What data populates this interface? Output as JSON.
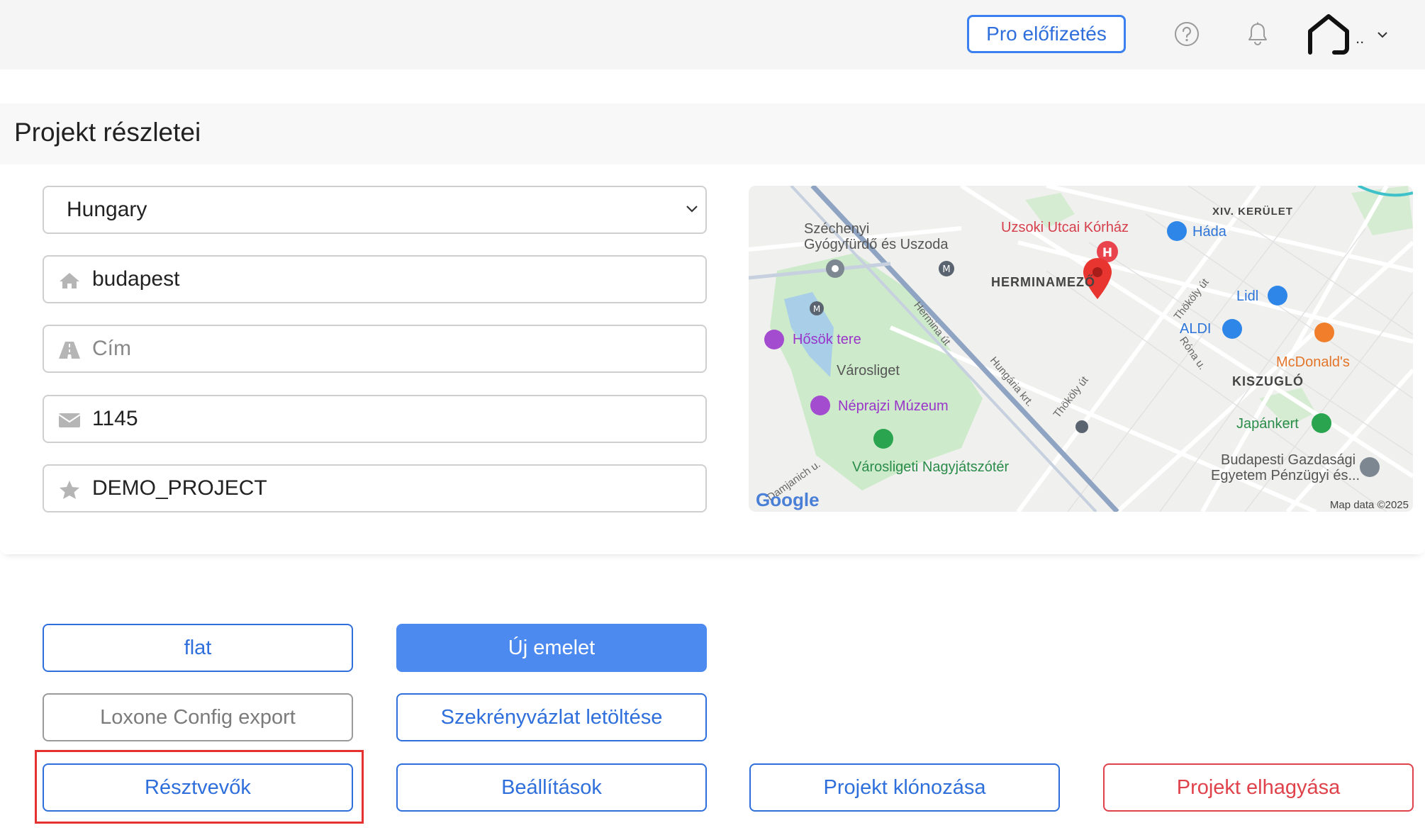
{
  "topbar": {
    "pro_label": "Pro előfizetés",
    "help_icon": "question-circle-icon",
    "bell_icon": "bell-icon",
    "logo_icon": "house-logo-icon",
    "logo_suffix": ".."
  },
  "details": {
    "title": "Projekt részletei",
    "country": {
      "value": "Hungary",
      "icon": "chevron-down-icon"
    },
    "city": {
      "value": "budapest",
      "icon": "home-icon"
    },
    "address": {
      "placeholder": "Cím",
      "icon": "road-icon"
    },
    "zip": {
      "value": "1145",
      "icon": "envelope-icon"
    },
    "project_name": {
      "value": "DEMO_PROJECT",
      "icon": "star-icon"
    }
  },
  "map": {
    "labels": {
      "szechenyi_1": "Széchenyi",
      "szechenyi_2": "Gyógyfürdő és Uszoda",
      "uzsoki": "Uzsoki Utcai Kórház",
      "xiv": "XIV. KERÜLET",
      "hada": "Háda",
      "herminamezo": "HERMINAMEZŐ",
      "lidl": "Lidl",
      "aldi": "ALDI",
      "mcdonalds": "McDonald's",
      "kiszuglo": "KISZUGLÓ",
      "hosok": "Hősök tere",
      "varosliget": "Városliget",
      "neprajzi": "Néprajzi Múzeum",
      "japankert": "Japánkert",
      "nagyjatszoter": "Városligeti Nagyjátszótér",
      "bge_1": "Budapesti Gazdasági",
      "bge_2": "Egyetem Pénzügyi és...",
      "hermina_ut": "Hermina út",
      "hungaria": "Hungária krt.",
      "thokoly_1": "Thököly út",
      "thokoly_2": "Thököly út",
      "rona": "Róna u.",
      "damjanich": "Damjanich u."
    },
    "google": "Google",
    "mapdata": "Map data ©2025"
  },
  "buttons": {
    "flat": "flat",
    "new_floor": "Új emelet",
    "loxone": "Loxone Config export",
    "cabinet": "Szekrényvázlat letöltése",
    "participants": "Résztvevők",
    "settings": "Beállítások",
    "clone": "Projekt klónozása",
    "leave": "Projekt elhagyása"
  },
  "colors": {
    "accent": "#2f6fdc",
    "primary_fill": "#4d8af0",
    "danger": "#e0424b",
    "highlight": "#e5312f"
  }
}
